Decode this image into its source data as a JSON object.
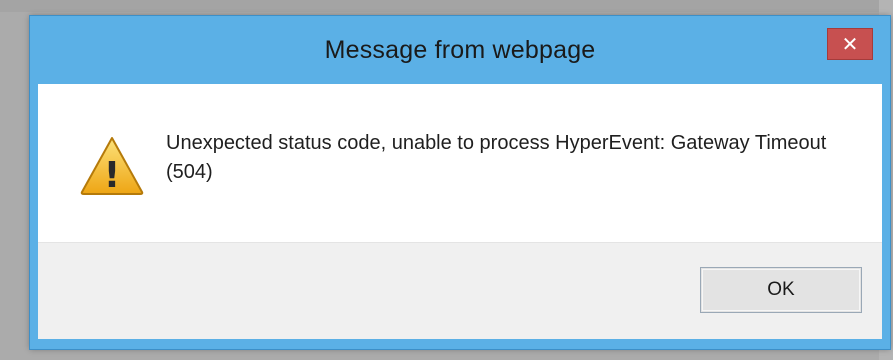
{
  "dialog": {
    "title": "Message from webpage",
    "close_icon": "close-icon",
    "close_symbol": "✕",
    "warning_icon": "warning-icon",
    "warning_symbol": "!",
    "message": "Unexpected status code, unable to process HyperEvent: Gateway Timeout (504)",
    "ok_label": "OK"
  },
  "colors": {
    "frame_accent": "#5bb0e6",
    "close_button": "#c75050",
    "warning_fill": "#f2b01e",
    "footer_background": "#f0f0f0",
    "client_background": "#ffffff"
  }
}
